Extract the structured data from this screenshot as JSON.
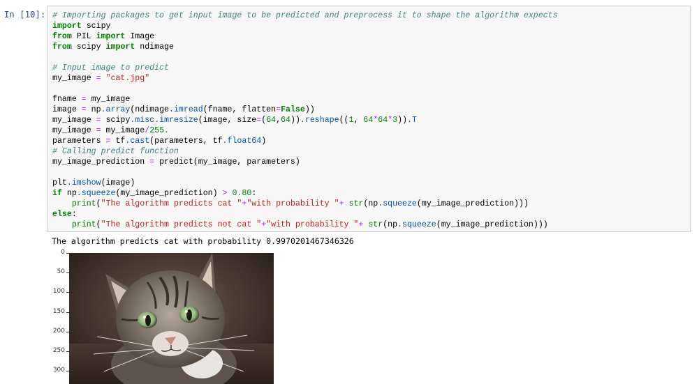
{
  "cell": {
    "prompt": "In [10]:",
    "lines": [
      [
        {
          "t": "# Importing packages to get input image to be predicted and preprocess it to shape the algorithm expects",
          "c": "cm"
        }
      ],
      [
        {
          "t": "import",
          "c": "kw"
        },
        {
          "t": " scipy"
        }
      ],
      [
        {
          "t": "from",
          "c": "kw"
        },
        {
          "t": " PIL "
        },
        {
          "t": "import",
          "c": "kw"
        },
        {
          "t": " Image"
        }
      ],
      [
        {
          "t": "from",
          "c": "kw"
        },
        {
          "t": " scipy "
        },
        {
          "t": "import",
          "c": "kw"
        },
        {
          "t": " ndimage"
        }
      ],
      [],
      [
        {
          "t": "# Input image to predict",
          "c": "cm"
        }
      ],
      [
        {
          "t": "my_image "
        },
        {
          "t": "=",
          "c": "op"
        },
        {
          "t": " "
        },
        {
          "t": "\"cat.jpg\"",
          "c": "st"
        }
      ],
      [],
      [
        {
          "t": "fname "
        },
        {
          "t": "=",
          "c": "op"
        },
        {
          "t": " my_image"
        }
      ],
      [
        {
          "t": "image "
        },
        {
          "t": "=",
          "c": "op"
        },
        {
          "t": " np"
        },
        {
          "t": ".array",
          "c": "at"
        },
        {
          "t": "(ndimage"
        },
        {
          "t": ".imread",
          "c": "at"
        },
        {
          "t": "(fname, flatten"
        },
        {
          "t": "=",
          "c": "op"
        },
        {
          "t": "False",
          "c": "kw"
        },
        {
          "t": "))"
        }
      ],
      [
        {
          "t": "my_image "
        },
        {
          "t": "=",
          "c": "op"
        },
        {
          "t": " scipy"
        },
        {
          "t": ".misc.imresize",
          "c": "at"
        },
        {
          "t": "(image, size"
        },
        {
          "t": "=",
          "c": "op"
        },
        {
          "t": "("
        },
        {
          "t": "64",
          "c": "nu"
        },
        {
          "t": ","
        },
        {
          "t": "64",
          "c": "nu"
        },
        {
          "t": "))"
        },
        {
          "t": ".reshape",
          "c": "at"
        },
        {
          "t": "(("
        },
        {
          "t": "1",
          "c": "nu"
        },
        {
          "t": ", "
        },
        {
          "t": "64",
          "c": "nu"
        },
        {
          "t": "*",
          "c": "op"
        },
        {
          "t": "64",
          "c": "nu"
        },
        {
          "t": "*",
          "c": "op"
        },
        {
          "t": "3",
          "c": "nu"
        },
        {
          "t": "))"
        },
        {
          "t": ".T",
          "c": "at"
        }
      ],
      [
        {
          "t": "my_image "
        },
        {
          "t": "=",
          "c": "op"
        },
        {
          "t": " my_image"
        },
        {
          "t": "/",
          "c": "op"
        },
        {
          "t": "255.",
          "c": "nu"
        }
      ],
      [
        {
          "t": "parameters "
        },
        {
          "t": "=",
          "c": "op"
        },
        {
          "t": " tf"
        },
        {
          "t": ".cast",
          "c": "at"
        },
        {
          "t": "(parameters, tf"
        },
        {
          "t": ".float64",
          "c": "at"
        },
        {
          "t": ")"
        }
      ],
      [
        {
          "t": "# Calling predict function",
          "c": "cm"
        }
      ],
      [
        {
          "t": "my_image_prediction "
        },
        {
          "t": "=",
          "c": "op"
        },
        {
          "t": " predict(my_image, parameters)"
        }
      ],
      [],
      [
        {
          "t": "plt"
        },
        {
          "t": ".imshow",
          "c": "at"
        },
        {
          "t": "(image)"
        }
      ],
      [
        {
          "t": "if",
          "c": "kw"
        },
        {
          "t": " np"
        },
        {
          "t": ".squeeze",
          "c": "at"
        },
        {
          "t": "(my_image_prediction) "
        },
        {
          "t": ">",
          "c": "op"
        },
        {
          "t": " "
        },
        {
          "t": "0.80",
          "c": "nu"
        },
        {
          "t": ":"
        }
      ],
      [
        {
          "t": "    "
        },
        {
          "t": "print",
          "c": "nu"
        },
        {
          "t": "("
        },
        {
          "t": "\"The algorithm predicts cat \"",
          "c": "st"
        },
        {
          "t": "+",
          "c": "op"
        },
        {
          "t": "\"with probability \"",
          "c": "st"
        },
        {
          "t": "+",
          "c": "op"
        },
        {
          "t": " "
        },
        {
          "t": "str",
          "c": "nu"
        },
        {
          "t": "(np"
        },
        {
          "t": ".squeeze",
          "c": "at"
        },
        {
          "t": "(my_image_prediction)))"
        }
      ],
      [
        {
          "t": "else",
          "c": "kw"
        },
        {
          "t": ":"
        }
      ],
      [
        {
          "t": "    "
        },
        {
          "t": "print",
          "c": "nu"
        },
        {
          "t": "("
        },
        {
          "t": "\"The algorithm predicts not cat \"",
          "c": "st"
        },
        {
          "t": "+",
          "c": "op"
        },
        {
          "t": "\"with probability \"",
          "c": "st"
        },
        {
          "t": "+",
          "c": "op"
        },
        {
          "t": " "
        },
        {
          "t": "str",
          "c": "nu"
        },
        {
          "t": "(np"
        },
        {
          "t": ".squeeze",
          "c": "at"
        },
        {
          "t": "(my_image_prediction)))"
        }
      ]
    ]
  },
  "output": {
    "text": "The algorithm predicts cat with probability 0.9970201467346326"
  },
  "plot": {
    "yticks": [
      "0",
      "50",
      "100",
      "150",
      "200",
      "250",
      "300"
    ],
    "image_subject": "tabby-cat-photo"
  },
  "colors": {
    "prompt": "#303f9f",
    "cell_bg": "#f7f7f7",
    "comment": "#408080",
    "keyword": "#008000",
    "string": "#ba2121"
  }
}
